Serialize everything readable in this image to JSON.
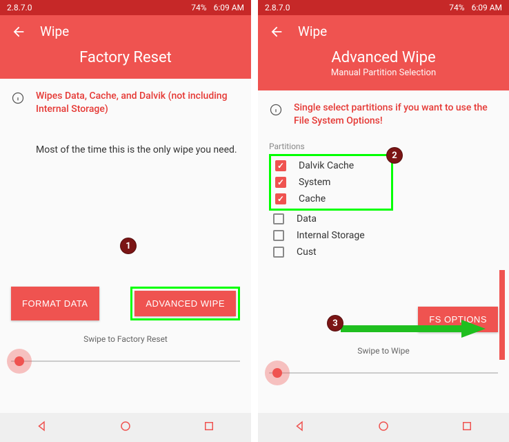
{
  "statusbar": {
    "version": "2.8.7.0",
    "battery": "74%",
    "time": "6:09 AM"
  },
  "left": {
    "header_title": "Wipe",
    "subtitle": "Factory Reset",
    "info_text": "Wipes Data, Cache, and Dalvik (not including Internal Storage)",
    "note_text": "Most of the time this is the only wipe you need.",
    "buttons": {
      "format": "FORMAT DATA",
      "advanced": "ADVANCED WIPE"
    },
    "swipe_label": "Swipe to Factory Reset"
  },
  "right": {
    "header_title": "Wipe",
    "subtitle": "Advanced Wipe",
    "subtext": "Manual Partition Selection",
    "info_text": "Single select partitions if you want to use the File System Options!",
    "partitions_label": "Partitions",
    "partitions": [
      {
        "label": "Dalvik Cache",
        "checked": true
      },
      {
        "label": "System",
        "checked": true
      },
      {
        "label": "Cache",
        "checked": true
      },
      {
        "label": "Data",
        "checked": false
      },
      {
        "label": "Internal Storage",
        "checked": false
      },
      {
        "label": "Cust",
        "checked": false
      }
    ],
    "buttons": {
      "fs": "FS OPTIONS"
    },
    "swipe_label": "Swipe to Wipe"
  },
  "annotations": {
    "badge1": "1",
    "badge2": "2",
    "badge3": "3"
  }
}
